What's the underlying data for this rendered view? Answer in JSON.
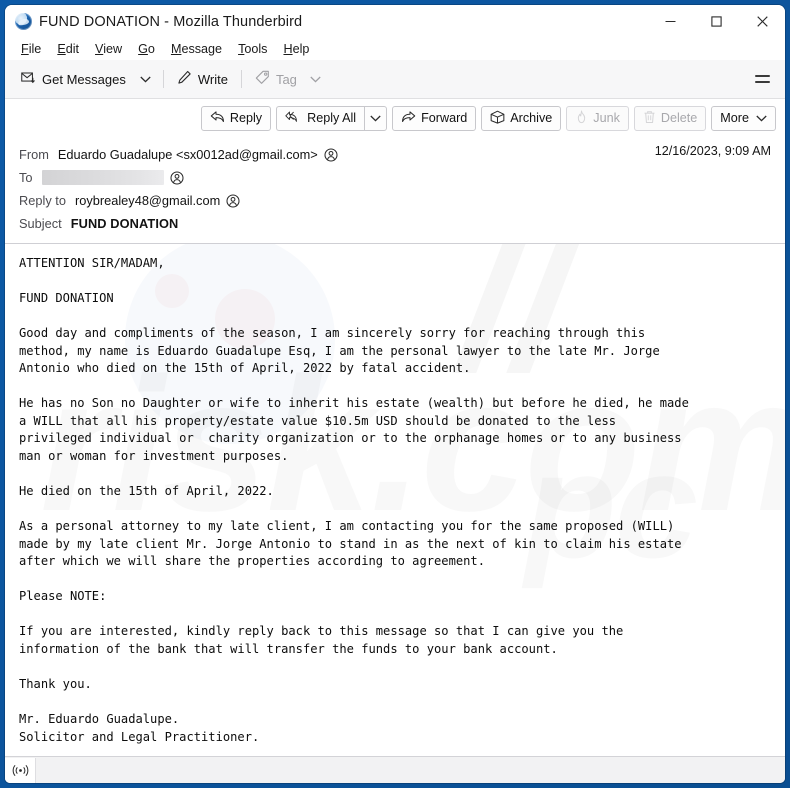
{
  "window": {
    "title": "FUND DONATION - Mozilla Thunderbird",
    "logo_icon": "thunderbird-logo",
    "controls": {
      "minimize": "minimize-icon",
      "maximize": "maximize-icon",
      "close": "close-icon"
    }
  },
  "menubar": {
    "items": [
      {
        "label": "File",
        "accesskey": "F"
      },
      {
        "label": "Edit",
        "accesskey": "E"
      },
      {
        "label": "View",
        "accesskey": "V"
      },
      {
        "label": "Go",
        "accesskey": "G"
      },
      {
        "label": "Message",
        "accesskey": "M"
      },
      {
        "label": "Tools",
        "accesskey": "T"
      },
      {
        "label": "Help",
        "accesskey": "H"
      }
    ]
  },
  "toolbar": {
    "get_messages": "Get Messages",
    "get_messages_icon": "envelope-download-icon",
    "get_messages_chevron": "chevron-down-icon",
    "write": "Write",
    "write_icon": "pencil-icon",
    "tag": "Tag",
    "tag_icon": "tag-icon",
    "tag_chevron": "chevron-down-icon",
    "tag_disabled": true,
    "app_menu_icon": "hamburger-menu-icon"
  },
  "message_actions": {
    "reply": "Reply",
    "reply_icon": "reply-arrow-icon",
    "reply_all": "Reply All",
    "reply_all_icon": "reply-all-arrow-icon",
    "reply_all_chevron": "chevron-down-icon",
    "forward": "Forward",
    "forward_icon": "forward-arrow-icon",
    "archive": "Archive",
    "archive_icon": "archive-box-icon",
    "junk": "Junk",
    "junk_icon": "flame-icon",
    "junk_disabled": true,
    "delete": "Delete",
    "delete_icon": "trash-can-icon",
    "delete_disabled": true,
    "more": "More",
    "more_chevron": "chevron-down-icon"
  },
  "headers": {
    "from_label": "From",
    "from_value": "Eduardo Guadalupe <sx0012ad@gmail.com>",
    "from_contact_icon": "contact-card-icon",
    "to_label": "To",
    "to_value_redacted": true,
    "to_contact_icon": "contact-card-icon",
    "reply_to_label": "Reply to",
    "reply_to_value": "roybrealey48@gmail.com",
    "reply_to_contact_icon": "contact-card-icon",
    "subject_label": "Subject",
    "subject_value": "FUND DONATION",
    "date": "12/16/2023, 9:09 AM"
  },
  "body": {
    "text": "ATTENTION SIR/MADAM,\n\nFUND DONATION\n\nGood day and compliments of the season, I am sincerely sorry for reaching through this\nmethod, my name is Eduardo Guadalupe Esq, I am the personal lawyer to the late Mr. Jorge\nAntonio who died on the 15th of April, 2022 by fatal accident.\n\nHe has no Son no Daughter or wife to inherit his estate (wealth) but before he died, he made\na WILL that all his property/estate value $10.5m USD should be donated to the less\nprivileged individual or  charity organization or to the orphanage homes or to any business\nman or woman for investment purposes.\n\nHe died on the 15th of April, 2022.\n\nAs a personal attorney to my late client, I am contacting you for the same proposed (WILL)\nmade by my late client Mr. Jorge Antonio to stand in as the next of kin to claim his estate\nafter which we will share the properties according to agreement.\n\nPlease NOTE:\n\nIf you are interested, kindly reply back to this message so that I can give you the\ninformation of the bank that will transfer the funds to your bank account.\n\nThank you.\n\nMr. Eduardo Guadalupe.\nSolicitor and Legal Practitioner.",
    "watermark": "pcrisk.com"
  },
  "statusbar": {
    "icon": "broadcast-signal-icon"
  },
  "colors": {
    "desktop": "#0a5096",
    "window_bg": "#ffffff",
    "toolbar_bg": "#f7f7f8",
    "statusbar_bg": "#f2f2f3",
    "text": "#121212",
    "muted_text": "#a0a0a4"
  }
}
